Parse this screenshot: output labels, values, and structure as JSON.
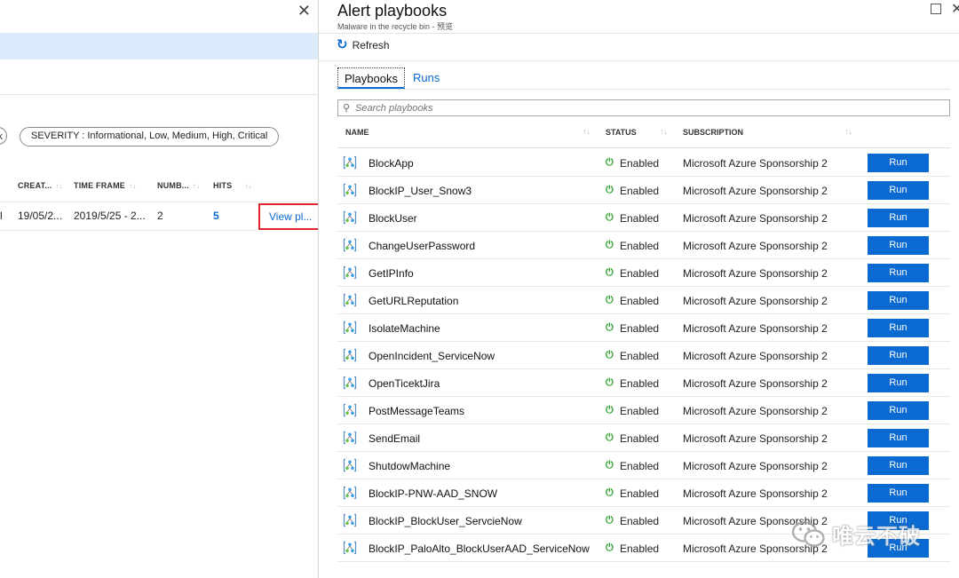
{
  "left": {
    "chip_partial": "k",
    "severity_filter": "SEVERITY : Informational, Low, Medium, High, Critical",
    "columns": [
      "CREAT...",
      "TIME FRAME",
      "NUMB...",
      "HITS"
    ],
    "row": {
      "partial": "l",
      "created": "19/05/2...",
      "time_frame": "2019/5/25 - 2...",
      "number": "2",
      "hits": "5",
      "view_link": "View pl..."
    },
    "close_glyph": "✕"
  },
  "right": {
    "title": "Alert playbooks",
    "subtitle": "Malware in the recycle bin - 预览",
    "refresh_label": "Refresh",
    "tabs": [
      "Playbooks",
      "Runs"
    ],
    "search_placeholder": "Search playbooks",
    "columns": {
      "name": "NAME",
      "status": "STATUS",
      "subscription": "SUBSCRIPTION"
    },
    "sort_glyph": "↑↓",
    "rows": [
      {
        "name": "BlockApp",
        "status": "Enabled",
        "subscription": "Microsoft Azure Sponsorship 2",
        "action": "Run"
      },
      {
        "name": "BlockIP_User_Snow3",
        "status": "Enabled",
        "subscription": "Microsoft Azure Sponsorship 2",
        "action": "Run"
      },
      {
        "name": "BlockUser",
        "status": "Enabled",
        "subscription": "Microsoft Azure Sponsorship 2",
        "action": "Run"
      },
      {
        "name": "ChangeUserPassword",
        "status": "Enabled",
        "subscription": "Microsoft Azure Sponsorship 2",
        "action": "Run"
      },
      {
        "name": "GetIPInfo",
        "status": "Enabled",
        "subscription": "Microsoft Azure Sponsorship 2",
        "action": "Run"
      },
      {
        "name": "GetURLReputation",
        "status": "Enabled",
        "subscription": "Microsoft Azure Sponsorship 2",
        "action": "Run"
      },
      {
        "name": "IsolateMachine",
        "status": "Enabled",
        "subscription": "Microsoft Azure Sponsorship 2",
        "action": "Run"
      },
      {
        "name": "OpenIncident_ServiceNow",
        "status": "Enabled",
        "subscription": "Microsoft Azure Sponsorship 2",
        "action": "Run"
      },
      {
        "name": "OpenTicektJira",
        "status": "Enabled",
        "subscription": "Microsoft Azure Sponsorship 2",
        "action": "Run"
      },
      {
        "name": "PostMessageTeams",
        "status": "Enabled",
        "subscription": "Microsoft Azure Sponsorship 2",
        "action": "Run"
      },
      {
        "name": "SendEmail",
        "status": "Enabled",
        "subscription": "Microsoft Azure Sponsorship 2",
        "action": "Run"
      },
      {
        "name": "ShutdowMachine",
        "status": "Enabled",
        "subscription": "Microsoft Azure Sponsorship 2",
        "action": "Run"
      },
      {
        "name": "BlockIP-PNW-AAD_SNOW",
        "status": "Enabled",
        "subscription": "Microsoft Azure Sponsorship 2",
        "action": "Run"
      },
      {
        "name": "BlockIP_BlockUser_ServcieNow",
        "status": "Enabled",
        "subscription": "Microsoft Azure Sponsorship 2",
        "action": "Run"
      },
      {
        "name": "BlockIP_PaloAlto_BlockUserAAD_ServiceNow",
        "status": "Enabled",
        "subscription": "Microsoft Azure Sponsorship 2",
        "action": "Run"
      }
    ]
  },
  "watermark": "唯云不破",
  "colors": {
    "accent": "#0b6ad1",
    "enabled_green": "#2ba02b",
    "highlight_red": "#e0262e",
    "selected_band": "#dcebfc"
  }
}
